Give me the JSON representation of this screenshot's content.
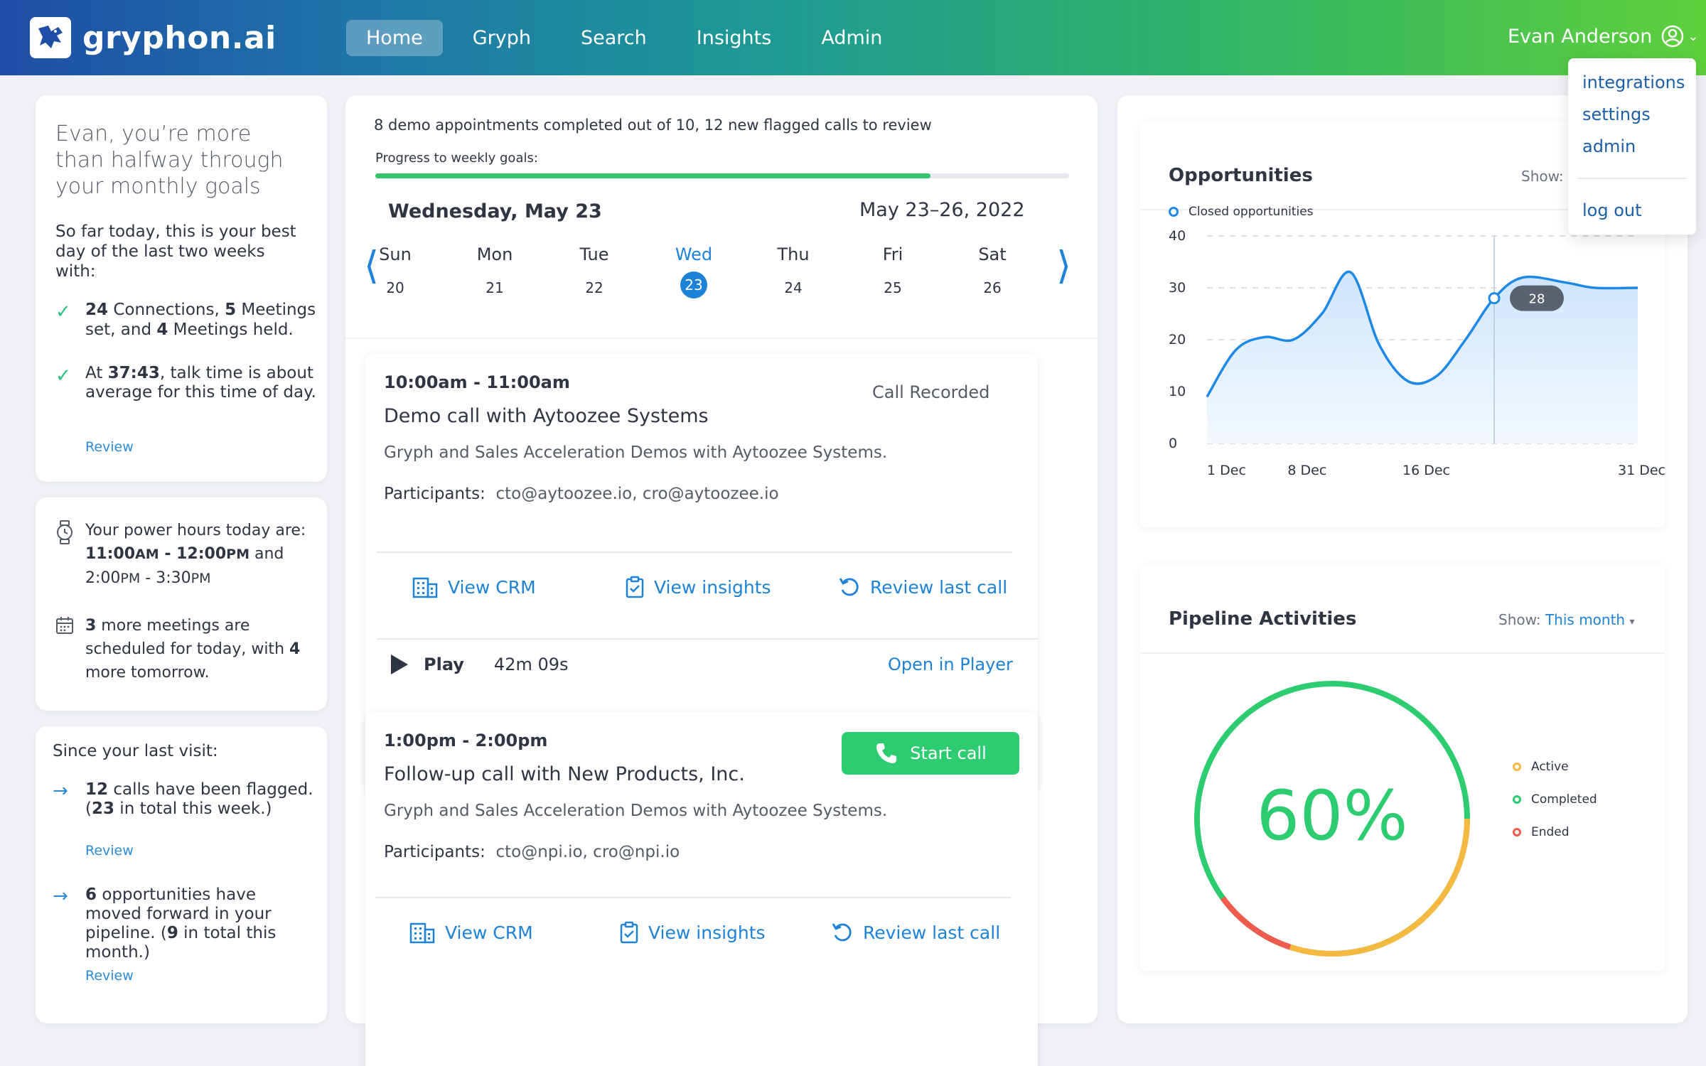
{
  "brand": {
    "name": "gryphon.ai"
  },
  "nav": {
    "items": [
      "Home",
      "Gryph",
      "Search",
      "Insights",
      "Admin"
    ],
    "active": "Home"
  },
  "user": {
    "name": "Evan Anderson"
  },
  "user_menu": {
    "items": [
      "integrations",
      "settings",
      "admin",
      "log out"
    ]
  },
  "greeting": {
    "title": "Evan, you’re more than halfway through your monthly goals",
    "subtitle": "So far today, this is your best day of the last two weeks with:",
    "item1": {
      "connections": "24",
      "connections_label": " Connections, ",
      "meetings_set": "5",
      "meetings_set_label": " Meetings set, and ",
      "meetings_held": "4",
      "meetings_held_label": " Meetings held."
    },
    "item2": {
      "prefix": "At ",
      "talk_time": "37:43",
      "suffix": ", talk time is about average for this time of day."
    },
    "review": "Review"
  },
  "power_hours": {
    "intro": "Your power hours today are:",
    "slot1_start": "11:00",
    "slot1_start_ampm": "AM",
    "slot1_sep": " - ",
    "slot1_end": "12:00",
    "slot1_end_ampm": "PM",
    "joiner": " and",
    "slot2_start": "2:00",
    "slot2_start_ampm": "PM",
    "slot2_sep": " - ",
    "slot2_end": "3:30",
    "slot2_end_ampm": "PM",
    "meetings_today": "3",
    "meetings_text": " more meetings are scheduled for today, with ",
    "meetings_tomorrow": "4",
    "meetings_tomorrow_text": " more tomorrow."
  },
  "since_visit": {
    "title": "Since your last visit:",
    "item1": {
      "count": "12",
      "text": " calls have been flagged. (",
      "total": "23",
      "suffix": " in total this week.)",
      "review": "Review"
    },
    "item2": {
      "count": "6",
      "text": " opportunities have moved forward in your pipeline. (",
      "total": "9",
      "suffix": " in total this month.)",
      "review": "Review"
    }
  },
  "summary": {
    "text": "8 demo appointments completed out of 10, 12 new flagged calls to review",
    "progress_label": "Progress to weekly goals:",
    "progress_fraction": 0.8
  },
  "calendar": {
    "selected_label": "Wednesday, May 23",
    "range_label": "May 23–26, 2022",
    "days": [
      {
        "dow": "Sun",
        "num": "20"
      },
      {
        "dow": "Mon",
        "num": "21"
      },
      {
        "dow": "Tue",
        "num": "22"
      },
      {
        "dow": "Wed",
        "num": "23"
      },
      {
        "dow": "Thu",
        "num": "24"
      },
      {
        "dow": "Fri",
        "num": "25"
      },
      {
        "dow": "Sat",
        "num": "26"
      }
    ],
    "selected_index": 3
  },
  "events": [
    {
      "time": "10:00am - 11:00am",
      "title": "Demo call with Aytoozee Systems",
      "status": "Call Recorded",
      "desc": "Gryph and Sales Acceleration Demos with Aytoozee Systems.",
      "participants_label": "Participants:",
      "participants": "cto@aytoozee.io, cro@aytoozee.io",
      "actions": [
        "View CRM",
        "View insights",
        "Review last call"
      ],
      "play_label": "Play",
      "duration": "42m 09s",
      "open_player": "Open in Player"
    },
    {
      "time": "1:00pm - 2:00pm",
      "title": "Follow-up call with New Products, Inc.",
      "start_call": "Start call",
      "desc": "Gryph and Sales Acceleration Demos with Aytoozee Systems.",
      "participants_label": "Participants:",
      "participants": "cto@npi.io, cro@npi.io",
      "actions": [
        "View CRM",
        "View insights",
        "Review last call"
      ]
    }
  ],
  "opportunities": {
    "title": "Opportunities",
    "show_label": "Show:"
  },
  "pipeline": {
    "title": "Pipeline Activities",
    "show_label": "Show:",
    "show_value": "This month",
    "percent": "60%",
    "legend": [
      "Active",
      "Completed",
      "Ended"
    ],
    "colors": {
      "active": "#f5b942",
      "completed": "#2ecc71",
      "ended": "#ef5b4c"
    }
  },
  "chart_data": {
    "type": "line",
    "title": "Opportunities",
    "series": [
      {
        "name": "Closed opportunities",
        "x": [
          "1 Dec",
          "3 Dec",
          "5 Dec",
          "7 Dec",
          "9 Dec",
          "11 Dec",
          "13 Dec",
          "15 Dec",
          "17 Dec",
          "19 Dec",
          "21 Dec",
          "23 Dec",
          "26 Dec",
          "28 Dec",
          "31 Dec"
        ],
        "values": [
          9,
          18,
          20.5,
          20,
          25,
          33,
          19,
          12,
          13,
          20,
          28,
          32,
          31,
          30,
          30
        ]
      }
    ],
    "x_ticks": [
      "1 Dec",
      "8 Dec",
      "16 Dec",
      "31 Dec"
    ],
    "y_ticks": [
      0,
      10,
      20,
      30,
      40
    ],
    "ylim": [
      0,
      40
    ],
    "highlight": {
      "x": "21 Dec",
      "value": 28,
      "label": "28"
    },
    "grid": true,
    "legend": "top-left",
    "color": "#1e88e5"
  }
}
